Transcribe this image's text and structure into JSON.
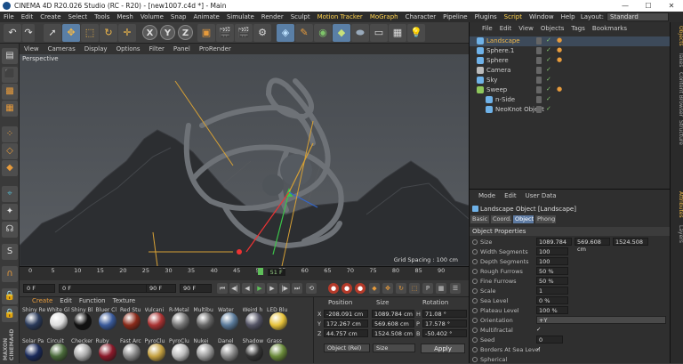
{
  "window": {
    "title": "CINEMA 4D R20.026 Studio (RC - R20) - [new1007.c4d *] - Main",
    "buttons": [
      "—",
      "☐",
      "✕"
    ]
  },
  "menu": {
    "items": [
      "File",
      "Edit",
      "Create",
      "Select",
      "Tools",
      "Mesh",
      "Volume",
      "Snap",
      "Animate",
      "Simulate",
      "Render",
      "Sculpt",
      "Motion Tracker",
      "MoGraph",
      "Character",
      "Pipeline",
      "Plugins",
      "Script",
      "Window",
      "Help"
    ],
    "layout_label": "Layout:",
    "layout_value": "Standard"
  },
  "viewport": {
    "menu": [
      "View",
      "Cameras",
      "Display",
      "Options",
      "Filter",
      "Panel",
      "ProRender"
    ],
    "label": "Perspective",
    "grid_spacing": "Grid Spacing : 100 cm"
  },
  "timeline": {
    "ticks": [
      "0",
      "5",
      "10",
      "15",
      "20",
      "25",
      "30",
      "35",
      "40",
      "45",
      "50",
      "55",
      "60",
      "65",
      "70",
      "75",
      "80",
      "85",
      "90"
    ],
    "current": "51 F",
    "current_frame": 51,
    "playback_range": [
      0,
      90
    ]
  },
  "playbar": {
    "start": "0 F",
    "cur": "0 F",
    "end1": "90 F",
    "end2": "90 F"
  },
  "materials": {
    "menu": [
      "Create",
      "Edit",
      "Function",
      "Texture"
    ],
    "row1": [
      {
        "name": "Shiny Re",
        "color": "#2a3a5a"
      },
      {
        "name": "White Gl",
        "color": "#ddd"
      },
      {
        "name": "Shiny Bl",
        "color": "#111"
      },
      {
        "name": "Bluer Cl",
        "color": "#3a5a9a"
      },
      {
        "name": "Red Stu",
        "color": "#8a2a1a"
      },
      {
        "name": "Vulcani",
        "color": "#a33"
      },
      {
        "name": "R-Metal",
        "color": "#777"
      },
      {
        "name": "Multibu",
        "color": "#666"
      },
      {
        "name": "Water",
        "color": "#5a7a9a"
      },
      {
        "name": "Weird h",
        "color": "#556"
      },
      {
        "name": "LED Blu",
        "color": "#e6c23a"
      }
    ],
    "row2": [
      {
        "name": "Solar Pa",
        "color": "#1a2a5a"
      },
      {
        "name": "Circuit",
        "color": "#4a6a3a"
      },
      {
        "name": "Checker",
        "color": "#aaa"
      },
      {
        "name": "Ruby",
        "color": "#8a1a2a"
      },
      {
        "name": "Fast Arc",
        "color": "#888"
      },
      {
        "name": "PyroClu",
        "color": "#c4a040"
      },
      {
        "name": "PyroClu",
        "color": "#bbb"
      },
      {
        "name": "Nukei",
        "color": "#999"
      },
      {
        "name": "Danel",
        "color": "#888"
      },
      {
        "name": "Shadow",
        "color": "#333"
      },
      {
        "name": "Grass",
        "color": "#6a8a3a"
      }
    ]
  },
  "coords": {
    "headers": {
      "position": "Position",
      "size": "Size",
      "rotation": "Rotation"
    },
    "rows": [
      {
        "axis": "X",
        "pos": "-208.091 cm",
        "size": "1089.784 cm",
        "rl": "H",
        "rot": "71.08 °"
      },
      {
        "axis": "Y",
        "pos": "172.267 cm",
        "size": "569.608 cm",
        "rl": "P",
        "rot": "17.578 °"
      },
      {
        "axis": "Z",
        "pos": "44.757 cm",
        "size": "1524.508 cm",
        "rl": "B",
        "rot": "-50.402 °"
      }
    ],
    "mode": "Object (Rel)",
    "size_mode": "Size",
    "apply": "Apply"
  },
  "objects": {
    "menu": [
      "File",
      "Edit",
      "View",
      "Objects",
      "Tags",
      "Bookmarks"
    ],
    "items": [
      {
        "name": "Landscape",
        "color": "#6fb2e8",
        "sel": true
      },
      {
        "name": "Sphere.1",
        "color": "#6fb2e8"
      },
      {
        "name": "Sphere",
        "color": "#6fb2e8"
      },
      {
        "name": "Camera",
        "color": "#bbb"
      },
      {
        "name": "Sky",
        "color": "#6fb2e8"
      },
      {
        "name": "Sweep",
        "color": "#8ec65c"
      },
      {
        "name": "n-Side",
        "color": "#6fb2e8"
      },
      {
        "name": "NeoKnot Object",
        "color": "#6fb2e8"
      }
    ]
  },
  "attributes": {
    "menu": [
      "Mode",
      "Edit",
      "User Data"
    ],
    "title": "Landscape Object [Landscape]",
    "tabs": [
      "Basic",
      "Coord.",
      "Object",
      "Phong"
    ],
    "section": "Object Properties",
    "size_label": "Size",
    "size": [
      "1089.784",
      "569.608 cm",
      "1524.508"
    ],
    "props": [
      {
        "label": "Width Segments",
        "value": "100"
      },
      {
        "label": "Depth Segments",
        "value": "100"
      },
      {
        "label": "Rough Furrows",
        "value": "50 %"
      },
      {
        "label": "Fine Furrows",
        "value": "50 %"
      },
      {
        "label": "Scale",
        "value": "1"
      },
      {
        "label": "Sea Level",
        "value": "0 %"
      },
      {
        "label": "Plateau Level",
        "value": "100 %"
      }
    ],
    "orientation_label": "Orientation",
    "orientation": "+Y",
    "multifractal": "Multifractal",
    "seed_label": "Seed",
    "seed": "0",
    "borders": "Borders At Sea Level",
    "spherical": "Spherical"
  },
  "right_tabs": [
    "Objects",
    "Takes",
    "Content Browser",
    "Structure",
    "Attributes",
    "Layers"
  ]
}
